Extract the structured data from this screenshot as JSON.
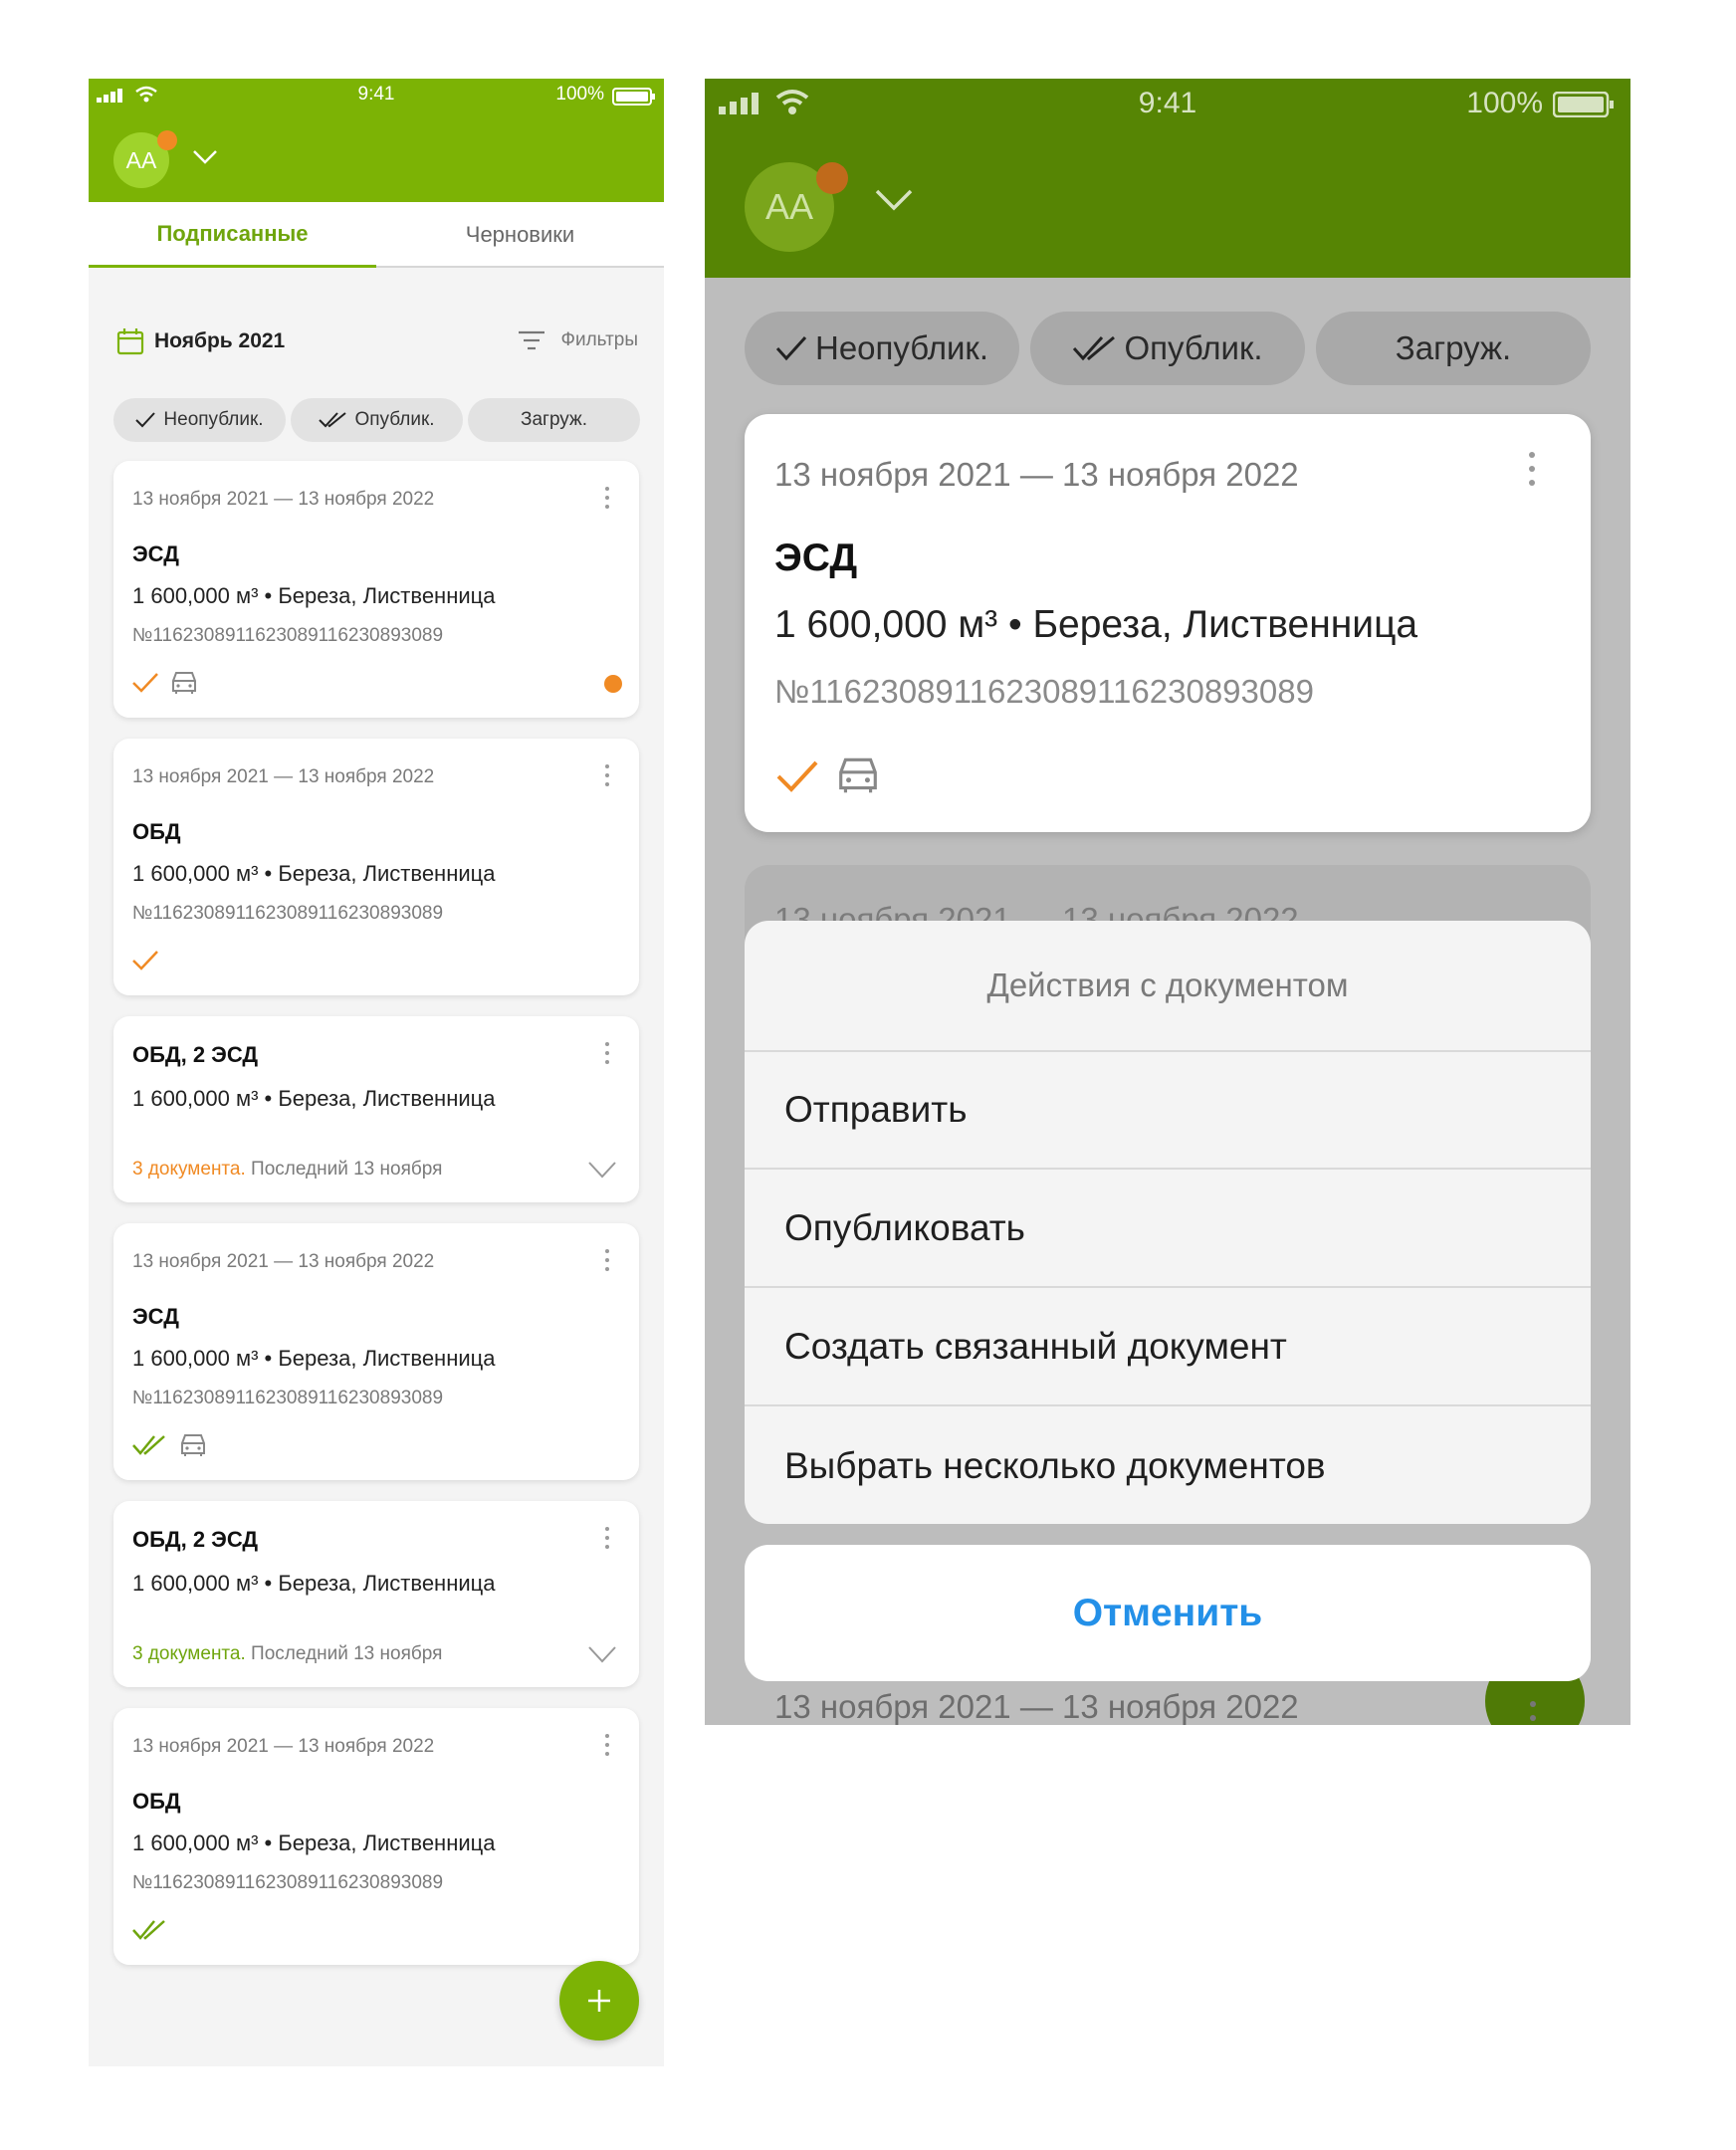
{
  "status_bar": {
    "time": "9:41",
    "battery": "100%"
  },
  "user": {
    "initials": "AA"
  },
  "tabs": [
    {
      "label": "Подписанные"
    },
    {
      "label": "Черновики"
    }
  ],
  "period": {
    "label": "Ноябрь 2021"
  },
  "filter": {
    "label": "Фильтры"
  },
  "chips": [
    {
      "label": "Неопублик.",
      "icon": "check-icon"
    },
    {
      "label": "Опублик.",
      "icon": "double-check-icon"
    },
    {
      "label": "Загруж.",
      "icon": ""
    }
  ],
  "cards": [
    {
      "date": "13 ноября 2021 — 13 ноября 2022",
      "title": "ЭСД",
      "volume": "1 600,000 м³ • Береза, Лиственница",
      "number": "№116230891162308911623089308 9",
      "status_icon": "check-orange-icon",
      "vehicle_icon": true,
      "dot": true
    },
    {
      "date": "13 ноября 2021 — 13 ноября 2022",
      "title": "ОБД",
      "volume": "1 600,000 м³ • Береза, Лиственница",
      "number": "№11623089116230891162308930 89",
      "status_icon": "check-orange-icon"
    },
    {
      "title": "ОБД, 2 ЭСД",
      "volume": "1 600,000 м³ • Береза, Лиственница",
      "docs_count": "3 документа.",
      "docs_last": " Последний 13 ноября",
      "docs_color": "#f08a24"
    },
    {
      "date": "13 ноября 2021 — 13 ноября 2022",
      "title": "ЭСД",
      "volume": "1 600,000 м³ • Береза, Лиственница",
      "number": "№11623089116230891162308930 89",
      "status_icon": "double-check-green-icon",
      "vehicle_icon": true
    },
    {
      "title": "ОБД, 2 ЭСД",
      "volume": "1 600,000 м³ • Береза, Лиственница",
      "docs_count": "3 документа.",
      "docs_last": " Последний 13 ноября",
      "docs_color": "#6fa50d"
    },
    {
      "date": "13 ноября 2021 — 13 ноября 2022",
      "title": "ОБД",
      "volume": "1 600,000 м³ • Береза, Лиственница",
      "number": "№11623089116230891162308930 89",
      "status_icon": "double-check-green-icon"
    }
  ],
  "action_sheet": {
    "title": "Действия с документом",
    "items": [
      "Отправить",
      "Опубликовать",
      "Создать связанный документ",
      "Выбрать несколько документов"
    ],
    "cancel": "Отменить"
  },
  "ghost_card_date": "13 ноября 2021 — 13 ноября 2022",
  "bottom_card_date": "13 ноября 2021 — 13 ноября 2022",
  "colors": {
    "brand_green": "#7cb305",
    "brand_green_dim": "#568504",
    "accent_orange": "#f08a24",
    "link_blue": "#2390e8"
  }
}
